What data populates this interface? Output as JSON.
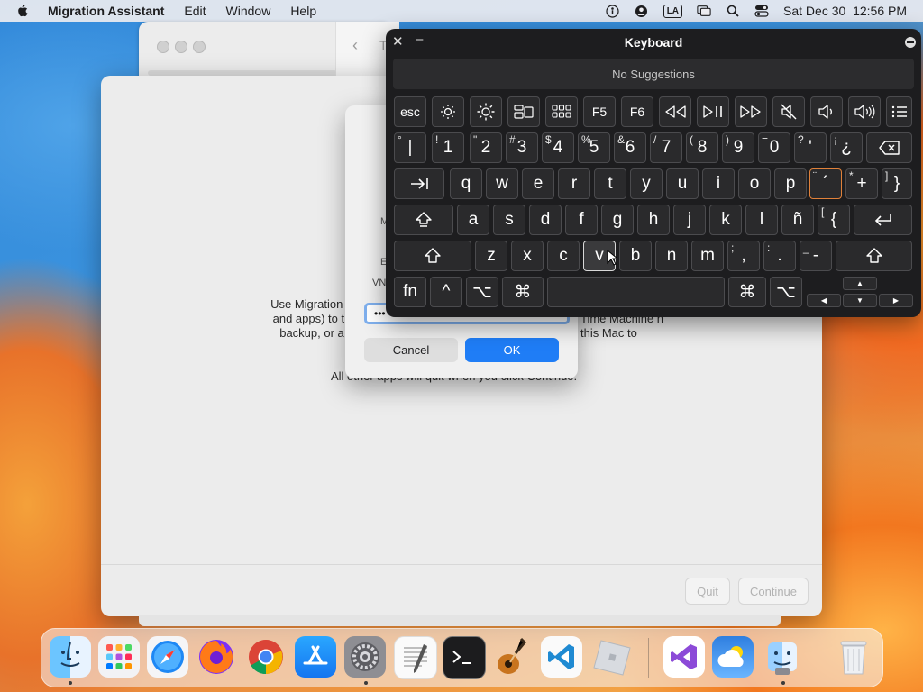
{
  "menubar": {
    "app_name": "Migration Assistant",
    "menus": [
      "Edit",
      "Window",
      "Help"
    ],
    "input_source": "LA",
    "datetime": "Sat Dec 30  12:56 PM"
  },
  "back_window": {
    "title_initial": "T"
  },
  "main_window": {
    "body_left": "Use Migration A and apps) to th backup, or a",
    "body_right": "Time Machine n this Mac to",
    "note": "All other apps will quit when you click Continue.",
    "quit_label": "Quit",
    "continue_label": "Continue"
  },
  "dialog": {
    "label_1": "M",
    "label_2": "E",
    "user_value": "VN",
    "password_value": "•••",
    "cancel_label": "Cancel",
    "ok_label": "OK"
  },
  "keyboard": {
    "title": "Keyboard",
    "suggestions": "No Suggestions",
    "esc": "esc",
    "f5": "F5",
    "f6": "F6",
    "num_row": [
      {
        "shift": "°",
        "main": "|"
      },
      {
        "shift": "!",
        "main": "1"
      },
      {
        "shift": "\"",
        "main": "2"
      },
      {
        "shift": "#",
        "main": "3"
      },
      {
        "shift": "$",
        "main": "4"
      },
      {
        "shift": "%",
        "main": "5"
      },
      {
        "shift": "&",
        "main": "6"
      },
      {
        "shift": "/",
        "main": "7"
      },
      {
        "shift": "(",
        "main": "8"
      },
      {
        "shift": ")",
        "main": "9"
      },
      {
        "shift": "=",
        "main": "0"
      },
      {
        "shift": "?",
        "main": "'"
      },
      {
        "shift": "¡",
        "main": "¿"
      }
    ],
    "q_row": [
      "q",
      "w",
      "e",
      "r",
      "t",
      "y",
      "u",
      "i",
      "o",
      "p"
    ],
    "q_row_extra": [
      {
        "shift": "¨",
        "main": "´"
      },
      {
        "shift": "*",
        "main": "+"
      },
      {
        "shift": "]",
        "main": "}"
      }
    ],
    "a_row": [
      "a",
      "s",
      "d",
      "f",
      "g",
      "h",
      "j",
      "k",
      "l",
      "ñ"
    ],
    "a_row_extra": {
      "shift": "[",
      "main": "{"
    },
    "z_row": [
      "z",
      "x",
      "c",
      "v",
      "b",
      "n",
      "m"
    ],
    "z_row_extra": [
      {
        "shift": ";",
        "main": ","
      },
      {
        "shift": ":",
        "main": "."
      },
      {
        "shift": "_",
        "main": "-"
      }
    ],
    "fn": "fn",
    "ctrl": "^",
    "opt": "⌥",
    "cmd": "⌘",
    "arrow_up": "▲",
    "arrow_left": "◀",
    "arrow_down": "▼",
    "arrow_right": "▶"
  },
  "dock": {
    "apps": [
      "Finder",
      "Launchpad",
      "Safari",
      "Firefox",
      "Chrome",
      "App Store",
      "System Settings",
      "TextEdit",
      "Terminal",
      "GarageBand",
      "Visual Studio Code",
      "Roblox",
      "Visual Studio",
      "Weather",
      "Migration Assistant",
      "Trash"
    ]
  }
}
